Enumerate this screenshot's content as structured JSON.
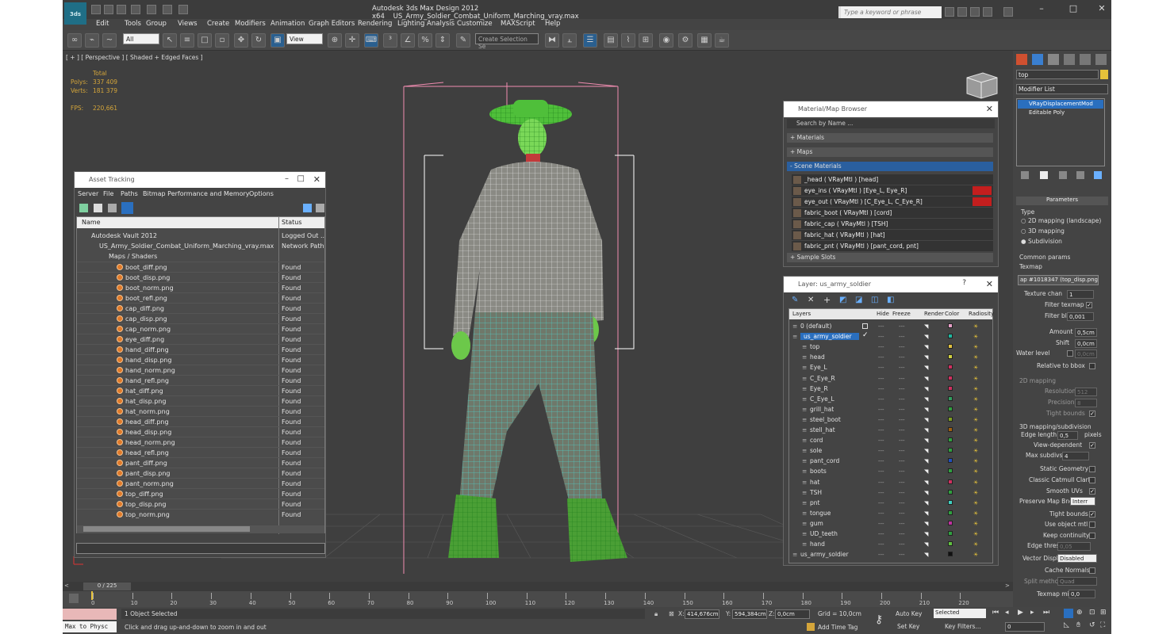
{
  "app": {
    "title": "Autodesk 3ds Max Design 2012 x64",
    "file": "US_Army_Soldier_Combat_Uniform_Marching_vray.max",
    "logo": "3ds",
    "search_placeholder": "Type a keyword or phrase"
  },
  "menu": [
    "Edit",
    "Tools",
    "Group",
    "Views",
    "Create",
    "Modifiers",
    "Animation",
    "Graph Editors",
    "Rendering",
    "Lighting Analysis",
    "Customize",
    "MAXScript",
    "Help"
  ],
  "toolbar": {
    "filter_value": "All",
    "refcoord_value": "View",
    "selection_set_placeholder": "Create Selection Se"
  },
  "viewport": {
    "label": "[ + ] [ Perspective ] [ Shaded + Edged Faces ]",
    "stats": {
      "total_label": "Total",
      "polys_label": "Polys:",
      "polys": "337 409",
      "verts_label": "Verts:",
      "verts": "181 379",
      "fps_label": "FPS:",
      "fps": "220,661"
    }
  },
  "asset_tracking": {
    "title": "Asset Tracking",
    "menu": [
      "Server",
      "File",
      "Paths",
      "Bitmap Performance and Memory",
      "Options"
    ],
    "col_name": "Name",
    "col_status": "Status",
    "vault": {
      "name": "Autodesk Vault 2012",
      "status": "Logged Out ..."
    },
    "file": {
      "name": "US_Army_Soldier_Combat_Uniform_Marching_vray.max",
      "status": "Network Path"
    },
    "group": "Maps / Shaders",
    "maps": [
      {
        "name": "boot_diff.png",
        "status": "Found"
      },
      {
        "name": "boot_disp.png",
        "status": "Found"
      },
      {
        "name": "boot_norm.png",
        "status": "Found"
      },
      {
        "name": "boot_refl.png",
        "status": "Found"
      },
      {
        "name": "cap_diff.png",
        "status": "Found"
      },
      {
        "name": "cap_disp.png",
        "status": "Found"
      },
      {
        "name": "cap_norm.png",
        "status": "Found"
      },
      {
        "name": "eye_diff.png",
        "status": "Found"
      },
      {
        "name": "hand_diff.png",
        "status": "Found"
      },
      {
        "name": "hand_disp.png",
        "status": "Found"
      },
      {
        "name": "hand_norm.png",
        "status": "Found"
      },
      {
        "name": "hand_refl.png",
        "status": "Found"
      },
      {
        "name": "hat_diff.png",
        "status": "Found"
      },
      {
        "name": "hat_disp.png",
        "status": "Found"
      },
      {
        "name": "hat_norm.png",
        "status": "Found"
      },
      {
        "name": "head_diff.png",
        "status": "Found"
      },
      {
        "name": "head_disp.png",
        "status": "Found"
      },
      {
        "name": "head_norm.png",
        "status": "Found"
      },
      {
        "name": "head_refl.png",
        "status": "Found"
      },
      {
        "name": "pant_diff.png",
        "status": "Found"
      },
      {
        "name": "pant_disp.png",
        "status": "Found"
      },
      {
        "name": "pant_norm.png",
        "status": "Found"
      },
      {
        "name": "top_diff.png",
        "status": "Found"
      },
      {
        "name": "top_disp.png",
        "status": "Found"
      },
      {
        "name": "top_norm.png",
        "status": "Found"
      }
    ]
  },
  "material_browser": {
    "title": "Material/Map Browser",
    "search_placeholder": "Search by Name ...",
    "sections": {
      "materials": "+ Materials",
      "maps": "+ Maps",
      "scene": "- Scene Materials",
      "samples": "+ Sample Slots"
    },
    "scene_materials": [
      "_head  ( VRayMtl ) [head]",
      "eye_ins  ( VRayMtl ) [Eye_L, Eye_R]",
      "eye_out  ( VRayMtl ) [C_Eye_L, C_Eye_R]",
      "fabric_boot  ( VRayMtl ) [cord]",
      "fabric_cap  ( VRayMtl ) [TSH]",
      "fabric_hat  ( VRayMtl ) [hat]",
      "fabric_pnt  ( VRayMtl ) [pant_cord, pnt]"
    ]
  },
  "layer_manager": {
    "title": "Layer: us_army_soldier",
    "cols": [
      "Layers",
      "Hide",
      "Freeze",
      "Render",
      "Color",
      "Radiosity"
    ],
    "layers": [
      {
        "name": "0 (default)",
        "color": "#e8a0c8"
      },
      {
        "name": "us_army_soldier",
        "color": "#20b8a0"
      },
      {
        "name": "top",
        "color": "#e0c040"
      },
      {
        "name": "head",
        "color": "#d0d040"
      },
      {
        "name": "Eye_L",
        "color": "#d03060"
      },
      {
        "name": "C_Eye_R",
        "color": "#d03060"
      },
      {
        "name": "Eye_R",
        "color": "#d03060"
      },
      {
        "name": "C_Eye_L",
        "color": "#30a060"
      },
      {
        "name": "grill_hat",
        "color": "#30a040"
      },
      {
        "name": "steel_boot",
        "color": "#80a020"
      },
      {
        "name": "stell_hat",
        "color": "#a06010"
      },
      {
        "name": "cord",
        "color": "#30a040"
      },
      {
        "name": "sole",
        "color": "#30a040"
      },
      {
        "name": "pant_cord",
        "color": "#2050c0"
      },
      {
        "name": "boots",
        "color": "#30a040"
      },
      {
        "name": "hat",
        "color": "#d03060"
      },
      {
        "name": "TSH",
        "color": "#30a040"
      },
      {
        "name": "pnt",
        "color": "#40d0c0"
      },
      {
        "name": "tongue",
        "color": "#30a040"
      },
      {
        "name": "gum",
        "color": "#c030a0"
      },
      {
        "name": "UD_teeth",
        "color": "#30a040"
      },
      {
        "name": "hand",
        "color": "#60c040"
      },
      {
        "name": "us_army_soldier",
        "color": "#111111"
      }
    ]
  },
  "command_panel": {
    "object_name": "top",
    "modifier_list": "Modifier List",
    "stack": [
      "VRayDisplacementMod",
      "Editable Poly"
    ],
    "rollout": "Parameters",
    "type_label": "Type",
    "type_options": [
      "2D mapping (landscape)",
      "3D mapping",
      "Subdivision"
    ],
    "common_params": "Common params",
    "texmap_label": "Texmap",
    "texmap_value": "ap #1018347 (top_disp.png)",
    "texture_chan_label": "Texture chan",
    "texture_chan": "1",
    "filter_texmap": "Filter texmap",
    "filter_blur_label": "Filter blur",
    "filter_blur": "0,001",
    "amount_label": "Amount",
    "amount": "0,5cm",
    "shift_label": "Shift",
    "shift": "0,0cm",
    "water_level_label": "Water level",
    "water_level": "0,0cm",
    "relative_bbox": "Relative to bbox",
    "mapping2d": "2D mapping",
    "resolution_label": "Resolution",
    "resolution": "512",
    "precision_label": "Precision",
    "precision": "8",
    "tight_bounds": "Tight bounds",
    "mapping3d": "3D mapping/subdivision",
    "edge_length_label": "Edge length",
    "edge_length": "0,5",
    "pixels": "pixels",
    "view_dependent": "View-dependent",
    "max_subdivs_label": "Max subdivs",
    "max_subdivs": "4",
    "static_geometry": "Static Geometry",
    "classic_catmull": "Classic Catmull Clark",
    "smooth_uvs": "Smooth UVs",
    "preserve_map_bnd": "Preserve Map Bnd",
    "preserve_value": "Interr",
    "tight_bounds2": "Tight bounds",
    "use_object_mtl": "Use object mtl",
    "keep_continuity": "Keep continuity",
    "edge_thresh_label": "Edge thresh",
    "edge_thresh": "0,05",
    "vector_displ_label": "Vector Displ",
    "vector_displ": "Disabled",
    "cache_normals": "Cache Normals",
    "split_method_label": "Split method",
    "split_method": "Quad",
    "texmap_min_label": "Texmap min",
    "texmap_min": "0,0"
  },
  "timeline": {
    "frame": "0 / 225",
    "ticks": [
      "0",
      "10",
      "20",
      "30",
      "40",
      "50",
      "60",
      "70",
      "80",
      "90",
      "100",
      "110",
      "120",
      "130",
      "140",
      "150",
      "160",
      "170",
      "180",
      "190",
      "200",
      "210",
      "220"
    ]
  },
  "status": {
    "script_label": "Max to Physc",
    "selected": "1 Object Selected",
    "prompt": "Click and drag up-and-down to zoom in and out",
    "x": "414,676cm",
    "y": "594,384cm",
    "z": "0,0cm",
    "grid": "Grid = 10,0cm",
    "add_time_tag": "Add Time Tag",
    "auto_key": "Auto Key",
    "set_key": "Set Key",
    "key_filters": "Key Filters...",
    "selected_dropdown": "Selected",
    "frame_field": "0"
  }
}
